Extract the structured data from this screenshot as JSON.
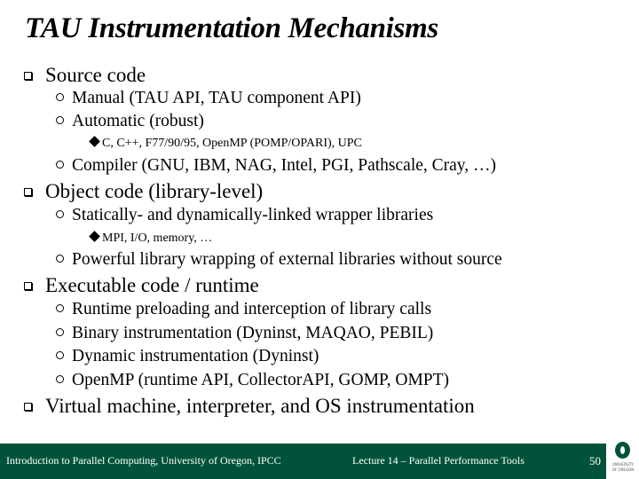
{
  "title": "TAU Instrumentation Mechanisms",
  "bullets": {
    "source_code": "Source code",
    "manual": "Manual (TAU API, TAU component API)",
    "automatic": "Automatic (robust)",
    "languages": "C, C++, F77/90/95, OpenMP (POMP/OPARI), UPC",
    "compiler": "Compiler (GNU, IBM, NAG, Intel, PGI, Pathscale, Cray, …)",
    "object_code": "Object code (library-level)",
    "wrapper_libs": "Statically- and dynamically-linked wrapper libraries",
    "wrapper_examples": "MPI, I/O, memory, …",
    "powerful_wrapping": "Powerful library wrapping of external libraries without source",
    "executable": "Executable code / runtime",
    "preloading": "Runtime preloading and interception of library calls",
    "binary": "Binary instrumentation (Dyninst, MAQAO, PEBIL)",
    "dynamic": "Dynamic instrumentation (Dyninst)",
    "openmp": "OpenMP (runtime API, CollectorAPI, GOMP, OMPT)",
    "virtual_machine": "Virtual machine, interpreter, and OS instrumentation"
  },
  "footer": {
    "course": "Introduction to Parallel Computing, University of Oregon, IPCC",
    "lecture": "Lecture 14 – Parallel Performance Tools",
    "page_number": "50",
    "logo_text_1": "UNIVERSITY",
    "logo_text_2": "OF OREGON",
    "color": "#00533a"
  }
}
